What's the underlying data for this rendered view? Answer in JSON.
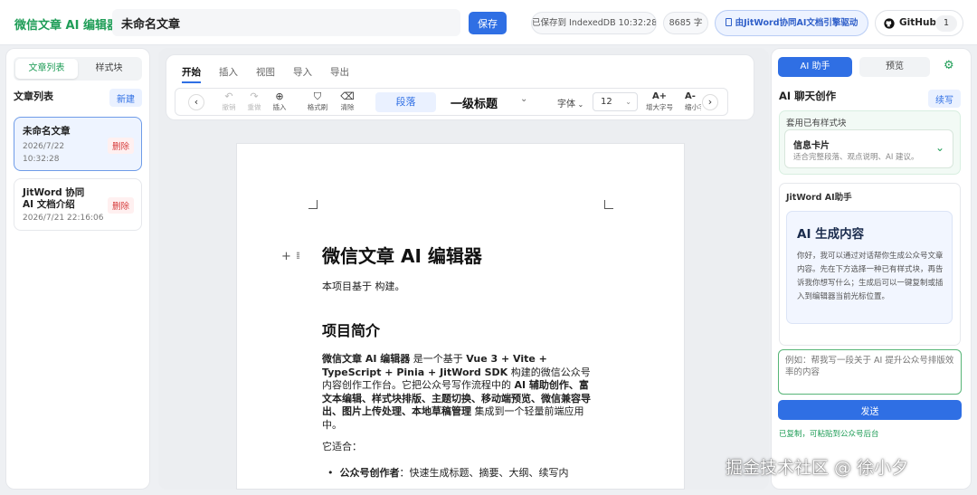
{
  "header": {
    "app_title": "微信文章 AI 编辑器",
    "doc_title": "未命名文章",
    "save_label": "保存",
    "save_status": "已保存到 IndexedDB 10:32:28",
    "char_count": "8685 字",
    "driven_label": "由JitWord协同AI文档引擎驱动",
    "github_label": "GitHub",
    "github_count": "1"
  },
  "sidebar": {
    "tabs": [
      "文章列表",
      "样式块"
    ],
    "heading": "文章列表",
    "new_label": "新建",
    "articles": [
      {
        "title": "未命名文章",
        "date": "2026/7/22 10:32:28",
        "delete": "删除"
      },
      {
        "title": "JitWord 协同 AI 文档介绍",
        "date": "2026/7/21 22:16:06",
        "delete": "删除"
      }
    ]
  },
  "editor": {
    "tabs": [
      "开始",
      "插入",
      "视图",
      "导入",
      "导出"
    ],
    "toolbar": {
      "undo": "撤销",
      "redo": "重做",
      "insert": "插入",
      "format_painter": "格式刷",
      "clear": "清除",
      "paragraph": "段落",
      "heading": "一级标题",
      "font": "字体",
      "font_size": "12",
      "grow_font": "增大字号",
      "shrink_font": "缩小字号"
    },
    "content": {
      "h1": "微信文章 AI 编辑器",
      "p1": "本项目基于 构建。",
      "h2": "项目简介",
      "intro_b1": "微信文章 AI 编辑器",
      "intro_t1": " 是一个基于 ",
      "intro_b2": "Vue 3 + Vite + TypeScript + Pinia + JitWord SDK",
      "intro_t2": " 构建的微信公众号内容创作工作台。它把公众号写作流程中的 ",
      "intro_b3": "AI 辅助创作、富文本编辑、样式块排版、主题切换、移动端预览、微信兼容导出、图片上传处理、本地草稿管理",
      "intro_t3": " 集成到一个轻量前端应用中。",
      "fit_label": "它适合：",
      "bullet1_b": "公众号创作者",
      "bullet1_t": "：快速生成标题、摘要、大纲、续写内"
    }
  },
  "assistant": {
    "tabs": [
      "AI 助手",
      "预览"
    ],
    "heading": "AI 聊天创作",
    "continue_label": "续写",
    "template_label": "套用已有样式块",
    "template_name": "信息卡片",
    "template_desc": "适合完整段落、观点说明、AI 建议。",
    "bot_name": "JitWord AI助手",
    "card_title": "AI 生成内容",
    "card_body": "你好，我可以通过对话帮你生成公众号文章内容。先在下方选择一种已有样式块，再告诉我你想写什么；生成后可以一键复制或插入到编辑器当前光标位置。",
    "input_placeholder": "例如：帮我写一段关于 AI 提升公众号排版效率的内容",
    "send_label": "发送",
    "copied_status": "已复制，可粘贴到公众号后台"
  },
  "watermark": "掘金技术社区 @ 徐小夕",
  "colors": {
    "accent": "#2f6fe4",
    "brand": "#1f9d57",
    "danger": "#d63b3b"
  }
}
